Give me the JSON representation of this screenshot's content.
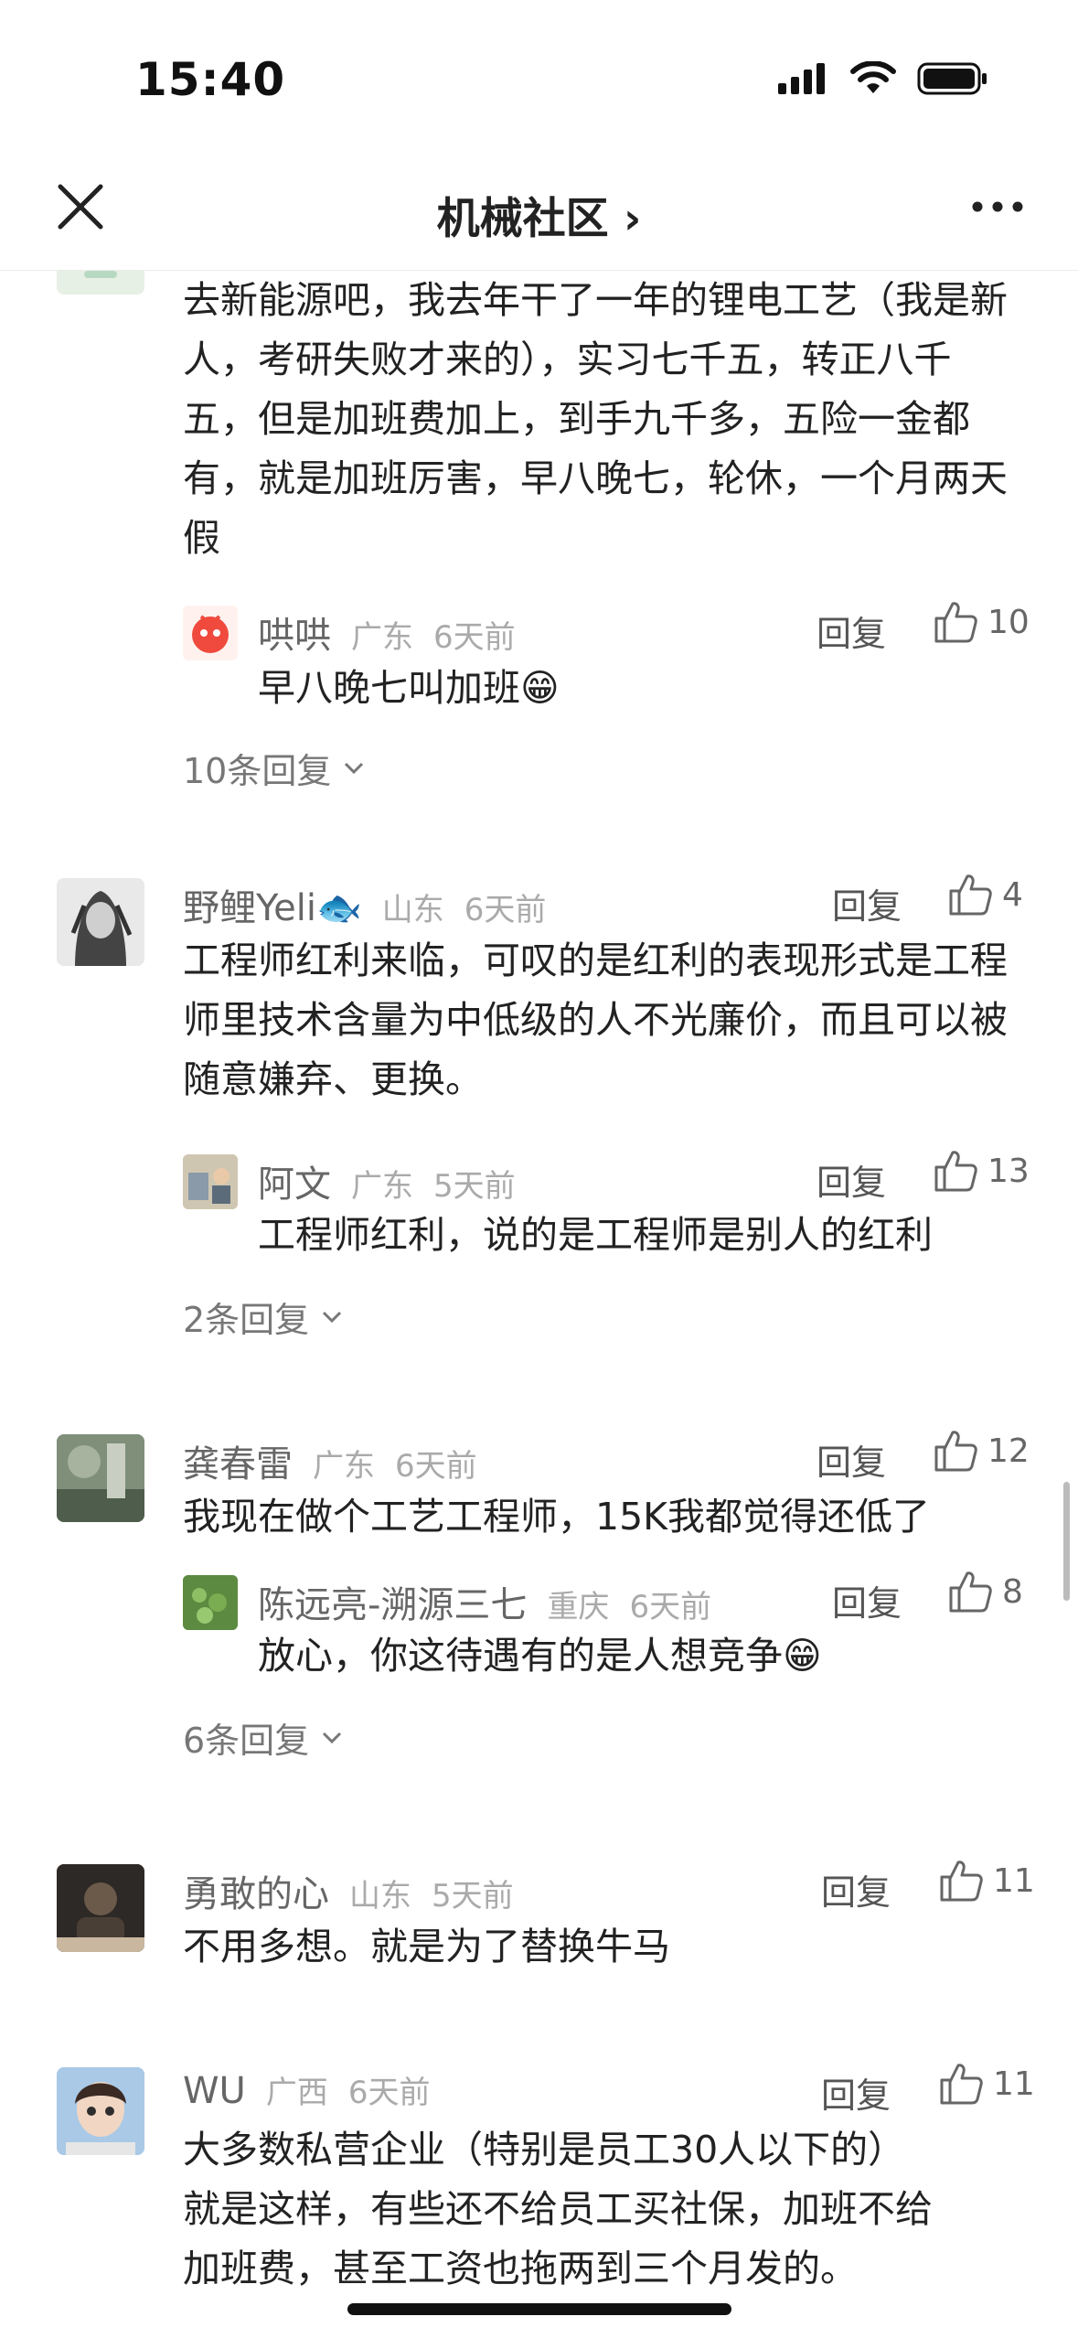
{
  "status": {
    "time": "15:40"
  },
  "nav": {
    "title": "机械社区 ›"
  },
  "comments": [
    {
      "text": "去新能源吧，我去年干了一年的锂电工艺（我是新人，考研失败才来的），实习七千五，转正八千五，但是加班费加上，到手九千多，五险一金都有，就是加班厉害，早八晚七，轮休，一个月两天假",
      "reply": {
        "author": "哄哄",
        "region": "广东",
        "time": "6天前",
        "reply_label": "回复",
        "likes": "10",
        "text": "早八晚七叫加班😁"
      },
      "more": "10条回复"
    },
    {
      "author": "野鲤Yeli🐟",
      "region": "山东",
      "time": "6天前",
      "reply_label": "回复",
      "likes": "4",
      "text": "工程师红利来临，可叹的是红利的表现形式是工程师里技术含量为中低级的人不光廉价，而且可以被随意嫌弃、更换。",
      "reply": {
        "author": "阿文",
        "region": "广东",
        "time": "5天前",
        "reply_label": "回复",
        "likes": "13",
        "text": "工程师红利，说的是工程师是别人的红利"
      },
      "more": "2条回复"
    },
    {
      "author": "龚春雷",
      "region": "广东",
      "time": "6天前",
      "reply_label": "回复",
      "likes": "12",
      "text": "我现在做个工艺工程师，15K我都觉得还低了",
      "reply": {
        "author": "陈远亮-溯源三七",
        "region": "重庆",
        "time": "6天前",
        "reply_label": "回复",
        "likes": "8",
        "text": "放心，你这待遇有的是人想竞争😁"
      },
      "more": "6条回复"
    },
    {
      "author": "勇敢的心",
      "region": "山东",
      "time": "5天前",
      "reply_label": "回复",
      "likes": "11",
      "text": "不用多想。就是为了替换牛马"
    },
    {
      "author": "WU",
      "region": "广西",
      "time": "6天前",
      "reply_label": "回复",
      "likes": "11",
      "text_lines": [
        "大多数私营企业（特别是员工30人以下的）",
        "就是这样，有些还不给员工买社保，加班不给",
        "加班费，甚至工资也拖两到三个月发的。"
      ]
    }
  ]
}
